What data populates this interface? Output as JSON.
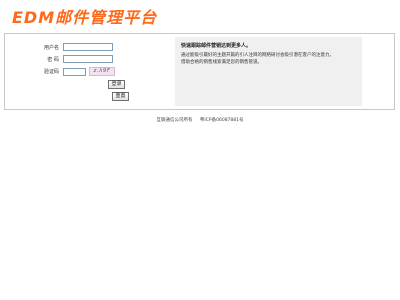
{
  "header": {
    "logo_text": "EDM邮件管理平台",
    "logo_color": "#ff6a1a"
  },
  "login_form": {
    "username_label": "用户名",
    "username_value": "",
    "password_label": "密 码",
    "password_value": "",
    "captcha_label": "验证码",
    "captcha_value": "",
    "captcha_image_text": "z.λ9F",
    "login_button": "登录",
    "reset_button": "重置"
  },
  "info": {
    "title": "快速跟踪邮件营销达到更多人。",
    "lines": [
      "通过能吸引最好的主题开篇的引人注目的网络研讨会吸引潜在客户的注意力。",
      "借助合格的销售线索满足您的销售管道。"
    ]
  },
  "footer": {
    "copyright": "互联通信公司所有",
    "icp": "粤ICP备06087881号"
  }
}
